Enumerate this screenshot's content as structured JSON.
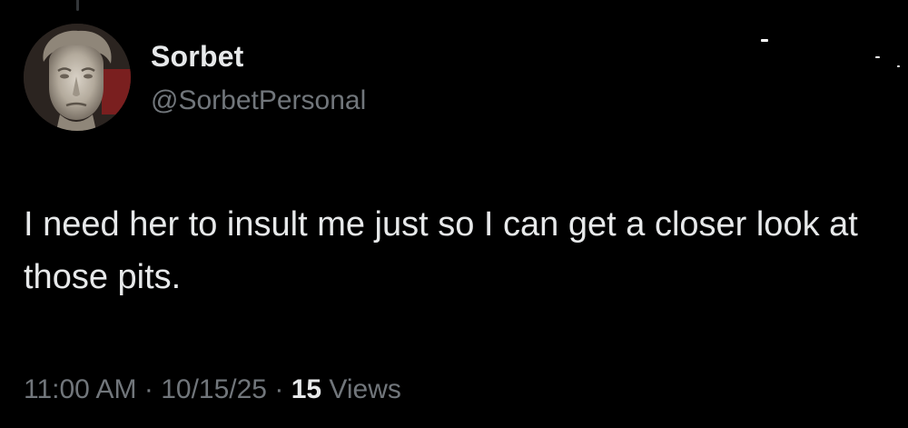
{
  "author": {
    "display_name": "Sorbet",
    "handle": "@SorbetPersonal",
    "avatar_icon": "statue-head-avatar"
  },
  "tweet": {
    "text": "I need her to insult me just so I can get a closer look at those pits."
  },
  "meta": {
    "time": "11:00 AM",
    "separator": "·",
    "date": "10/15/25",
    "views_count": "15",
    "views_label": "Views"
  },
  "colors": {
    "background": "#000000",
    "primary_text": "#e7e9ea",
    "secondary_text": "#71767b"
  }
}
